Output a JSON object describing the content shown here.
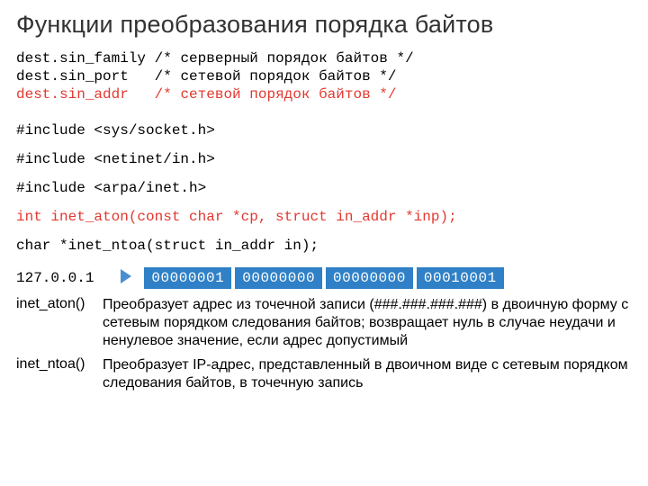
{
  "title": "Функции преобразования порядка байтов",
  "struct_lines": [
    {
      "left": "dest.sin_family",
      "comment": "/* серверный порядок байтов */",
      "red": false
    },
    {
      "left": "dest.sin_port  ",
      "comment": "/* сетевой порядок байтов */",
      "red": false
    },
    {
      "left": "dest.sin_addr  ",
      "comment": "/* сетевой порядок байтов */",
      "red": true
    }
  ],
  "includes": [
    "#include <sys/socket.h>",
    "#include <netinet/in.h>",
    "#include <arpa/inet.h>"
  ],
  "sig_aton": "int inet_aton(const char *cp, struct in_addr *inp);",
  "sig_ntoa": "char *inet_ntoa(struct in_addr in);",
  "ip_str": "127.0.0.1",
  "bytes": [
    "00000001",
    "00000000",
    "00000000",
    "00010001"
  ],
  "defs": [
    {
      "name": "inet_aton()",
      "text": "Преобразует адрес из точечной записи (###.###.###.###) в двоичную форму с сетевым порядком следования байтов; возвращает нуль в случае неудачи и ненулевое значение, если адрес допустимый"
    },
    {
      "name": "inet_ntoa()",
      "text": "Преобразует IP-адрес, представленный в двоичном виде с сетевым порядком следования байтов, в точечную запись"
    }
  ]
}
